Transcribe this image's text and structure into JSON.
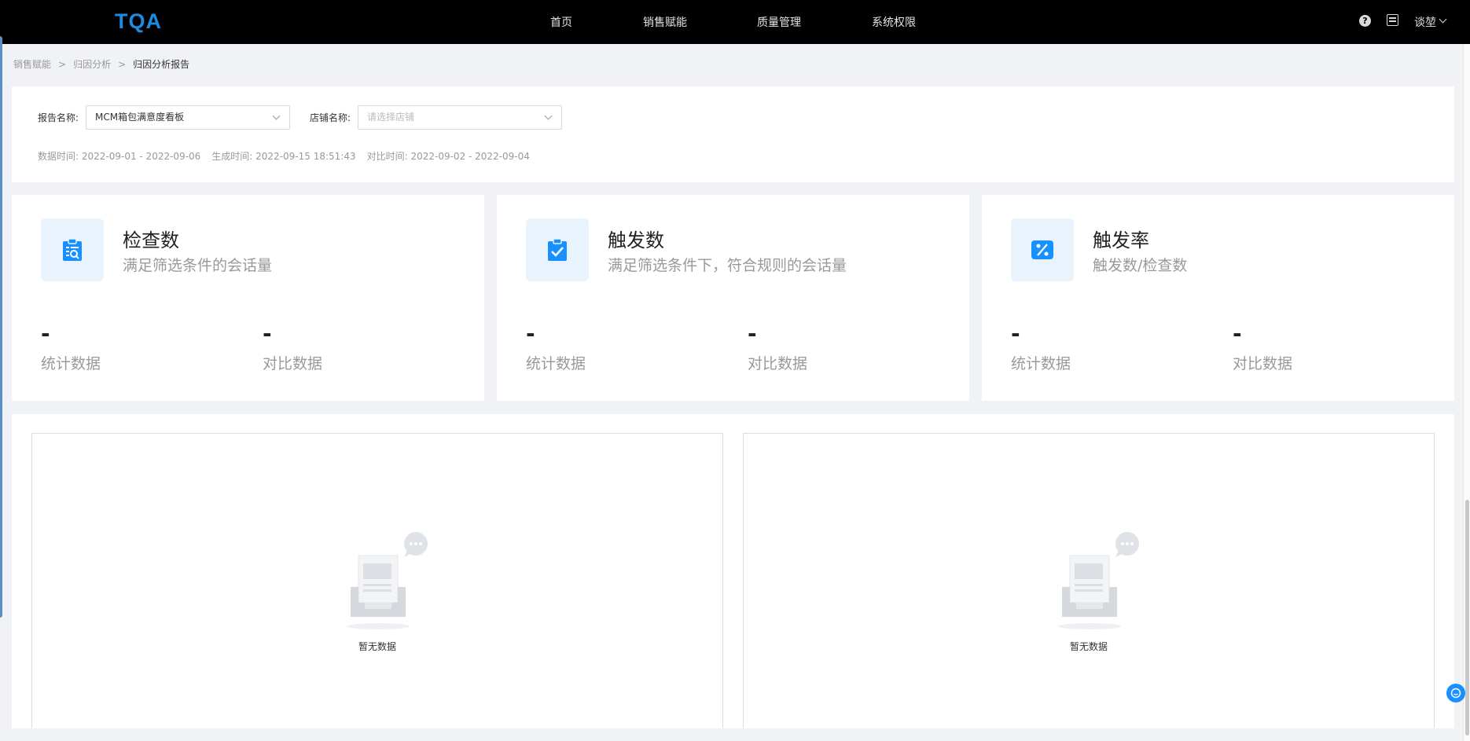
{
  "app": {
    "logo_text": "TQA"
  },
  "topnav": {
    "items": [
      {
        "label": "首页"
      },
      {
        "label": "销售赋能"
      },
      {
        "label": "质量管理"
      },
      {
        "label": "系统权限"
      }
    ],
    "help_icon": "help-icon",
    "doc_icon": "document-icon",
    "user_name": "谈堃"
  },
  "breadcrumb": {
    "items": [
      "销售赋能",
      "归因分析",
      "归因分析报告"
    ],
    "separator": ">"
  },
  "filters": {
    "report_label": "报告名称:",
    "report_value": "MCM箱包满意度看板",
    "store_label": "店铺名称:",
    "store_placeholder": "请选择店铺",
    "data_time": "数据时间: 2022-09-01 - 2022-09-06",
    "generated_time": "生成时间: 2022-09-15 18:51:43",
    "compare_time": "对比时间: 2022-09-02 - 2022-09-04"
  },
  "stat_cards": [
    {
      "icon": "clipboard-search-icon",
      "title": "检查数",
      "subtitle": "满足筛选条件的会话量",
      "stat_value": "-",
      "stat_label": "统计数据",
      "compare_value": "-",
      "compare_label": "对比数据"
    },
    {
      "icon": "clipboard-check-icon",
      "title": "触发数",
      "subtitle": "满足筛选条件下，符合规则的会话量",
      "stat_value": "-",
      "stat_label": "统计数据",
      "compare_value": "-",
      "compare_label": "对比数据"
    },
    {
      "icon": "percent-icon",
      "title": "触发率",
      "subtitle": "触发数/检查数",
      "stat_value": "-",
      "stat_label": "统计数据",
      "compare_value": "-",
      "compare_label": "对比数据"
    }
  ],
  "charts": [
    {
      "empty_text": "暂无数据"
    },
    {
      "empty_text": "暂无数据"
    }
  ],
  "colors": {
    "accent": "#1890ff",
    "nav_bg": "#000000",
    "icon_bg": "#e8f3fd"
  }
}
